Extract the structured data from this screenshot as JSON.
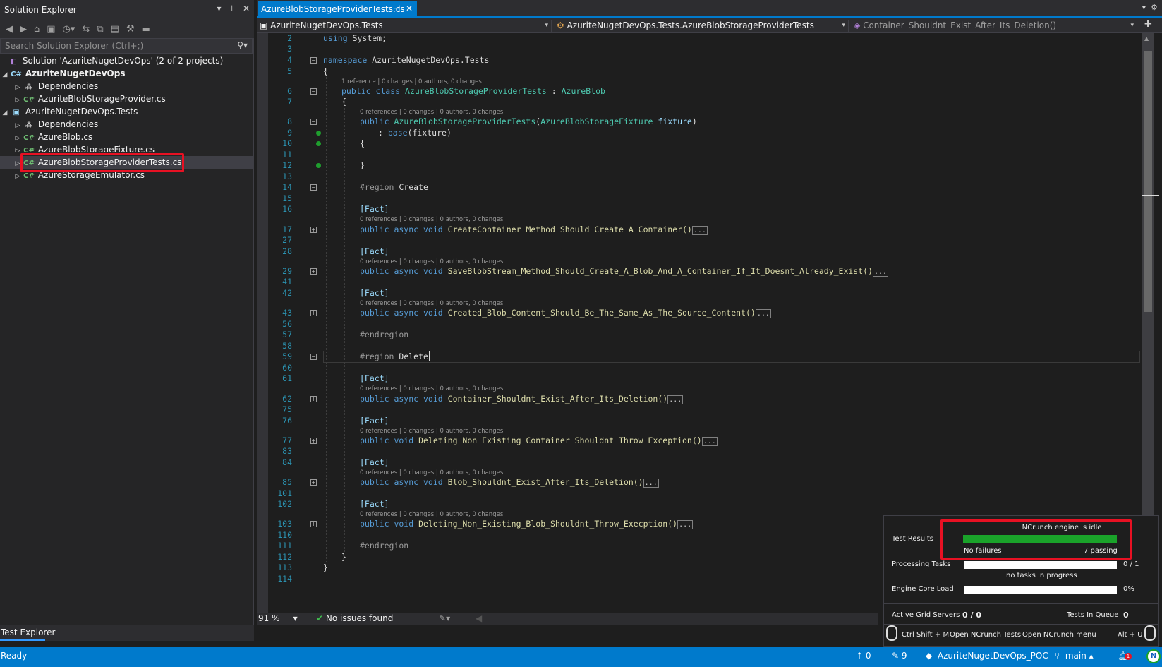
{
  "solution_explorer": {
    "title": "Solution Explorer",
    "search_placeholder": "Search Solution Explorer (Ctrl+;)",
    "items": [
      {
        "label": "Solution 'AzuriteNugetDevOps' (2 of 2 projects)"
      },
      {
        "label": "AzuriteNugetDevOps"
      },
      {
        "label": "Dependencies"
      },
      {
        "label": "AzuriteBlobStorageProvider.cs"
      },
      {
        "label": "AzuriteNugetDevOps.Tests"
      },
      {
        "label": "Dependencies"
      },
      {
        "label": "AzureBlob.cs"
      },
      {
        "label": "AzureBlobStorageFixture.cs"
      },
      {
        "label": "AzureBlobStorageProviderTests.cs"
      },
      {
        "label": "AzureStorageEmulator.cs"
      }
    ]
  },
  "test_explorer_tab": "Test Explorer",
  "editor": {
    "tab_label": "AzureBlobStorageProviderTests.cs",
    "nav": {
      "project": "AzuriteNugetDevOps.Tests",
      "class": "AzuriteNugetDevOps.Tests.AzureBlobStorageProviderTests",
      "member": "Container_Shouldnt_Exist_After_Its_Deletion()"
    },
    "lens_single": "1 reference | 0 changes | 0 authors, 0 changes",
    "lens_zero": "0 references | 0 changes | 0 authors, 0 changes",
    "lines": {
      "l2": "2",
      "l3": "3",
      "l4": "4",
      "l5": "5",
      "l6": "6",
      "l7": "7",
      "l8": "8",
      "l9": "9",
      "l10": "10",
      "l11": "11",
      "l12": "12",
      "l13": "13",
      "l14": "14",
      "l15": "15",
      "l16": "16",
      "l17": "17",
      "l27": "27",
      "l28": "28",
      "l29": "29",
      "l41": "41",
      "l42": "42",
      "l43": "43",
      "l56": "56",
      "l57": "57",
      "l58": "58",
      "l59": "59",
      "l60": "60",
      "l61": "61",
      "l62": "62",
      "l75": "75",
      "l76": "76",
      "l77": "77",
      "l83": "83",
      "l84": "84",
      "l85": "85",
      "l101": "101",
      "l102": "102",
      "l103": "103",
      "l110": "110",
      "l111": "111",
      "l112": "112",
      "l113": "113",
      "l114": "114"
    },
    "code": {
      "using_kw": "using",
      "using_rest": " System;",
      "ns_kw": "namespace",
      "ns_name": " AzuriteNugetDevOps.Tests",
      "open_brace": "{",
      "close_brace": "}",
      "class_kw": "public class",
      "class_name": "AzureBlobStorageProviderTests",
      "class_sep": " : ",
      "class_base": "AzureBlob",
      "ctor_kw": "public",
      "ctor_name": "AzureBlobStorageProviderTests",
      "ctor_open": "(",
      "ctor_ptype": "AzureBlobStorageFixture",
      "ctor_pname": " fixture",
      "ctor_close": ")",
      "base_pre": ": ",
      "base_kw": "base",
      "base_args": "(fixture)",
      "region_kw": "#region",
      "region_create": " Create",
      "region_delete": " Delete",
      "endregion": "#endregion",
      "fact": "[Fact]",
      "pub_async_void": "public async void",
      "pub_void": "public void",
      "ellipsis": "...",
      "m1": "CreateContainer_Method_Should_Create_A_Container()",
      "m2": "SaveBlobStream_Method_Should_Create_A_Blob_And_A_Container_If_It_Doesnt_Already_Exist()",
      "m3": "Created_Blob_Content_Should_Be_The_Same_As_The_Source_Content()",
      "m4": "Container_Shouldnt_Exist_After_Its_Deletion()",
      "m5": "Deleting_Non_Existing_Container_Shouldnt_Throw_Exception()",
      "m6": "Blob_Shouldnt_Exist_After_Its_Deletion()",
      "m7": "Deleting_Non_Existing_Blob_Shouldnt_Throw_Execption()"
    },
    "zoom": "91 %",
    "issues": "No issues found"
  },
  "ncrunch": {
    "engine_status": "NCrunch engine is idle",
    "test_results_label": "Test Results",
    "no_failures": "No failures",
    "passing": "7 passing",
    "passing_fraction": 1.0,
    "processing_label": "Processing Tasks",
    "processing_value": "0 / 1",
    "no_tasks": "no tasks in progress",
    "engine_load_label": "Engine Core Load",
    "engine_load_value": "0%",
    "grid_label": "Active Grid Servers",
    "grid_value": "0 / 0",
    "queue_label": "Tests In Queue",
    "queue_value": "0",
    "shortcut_left": "Ctrl Shift + M",
    "open_tests": "Open NCrunch Tests",
    "open_menu": "Open NCrunch menu",
    "shortcut_right": "Alt + U"
  },
  "statusbar": {
    "ready": "Ready",
    "up_count": "0",
    "edit_count": "9",
    "repo": "AzuriteNugetDevOps_POC",
    "branch": "main",
    "notif_count": "1",
    "ncrunch_letter": "N"
  },
  "colors": {
    "accent": "#007acc",
    "highlight_box": "#e81123",
    "pass_bar": "#1aa32a"
  }
}
